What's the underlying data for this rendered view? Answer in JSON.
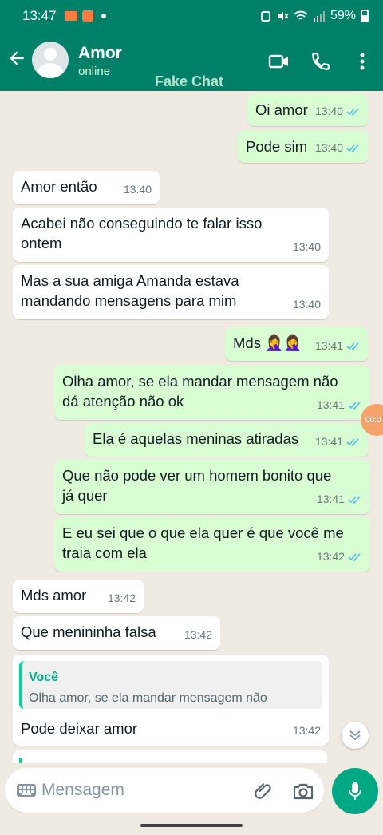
{
  "status_bar": {
    "time": "13:47",
    "battery": "59%"
  },
  "header": {
    "contact_name": "Amor",
    "contact_status": "online",
    "watermark": "Fake Chat",
    "icons": [
      "back-arrow-icon",
      "video-call-icon",
      "phone-icon",
      "more-options-icon"
    ]
  },
  "messages": [
    {
      "dir": "out",
      "text": "Oi amor",
      "time": "13:40",
      "read": true
    },
    {
      "dir": "out",
      "text": "Pode sim",
      "time": "13:40",
      "read": true
    },
    {
      "dir": "in",
      "text": "Amor então",
      "time": "13:40"
    },
    {
      "dir": "in",
      "text": "Acabei não conseguindo te falar isso\nontem",
      "time": "13:40"
    },
    {
      "dir": "in",
      "text": "Mas a sua amiga Amanda estava\nmandando mensagens para mim",
      "time": "13:40"
    },
    {
      "dir": "out",
      "text": "Mds 🤦‍♀️🤦‍♀️",
      "time": "13:41",
      "read": true
    },
    {
      "dir": "out",
      "text": "Olha amor, se ela mandar mensagem não\ndá atenção não ok",
      "time": "13:41",
      "read": true
    },
    {
      "dir": "out",
      "text": "Ela é aquelas meninas atiradas",
      "time": "13:41",
      "read": true
    },
    {
      "dir": "out",
      "text": "Que não pode ver um homem bonito que\njá quer",
      "time": "13:41",
      "read": true
    },
    {
      "dir": "out",
      "text": "E eu sei que o que ela quer é que você me\ntraia com ela",
      "time": "13:42",
      "read": true
    },
    {
      "dir": "in",
      "text": "Mds amor",
      "time": "13:42"
    },
    {
      "dir": "in",
      "text": "Que menininha falsa",
      "time": "13:42"
    },
    {
      "dir": "in",
      "text": "Pode deixar amor",
      "time": "13:42",
      "quote": {
        "author": "Você",
        "text": "Olha amor, se ela mandar mensagem não"
      }
    }
  ],
  "recording_badge": "00:0",
  "composer": {
    "placeholder": "Mensagem"
  },
  "colors": {
    "header": "#008069",
    "outgoing": "#d9fdd3",
    "incoming": "#ffffff",
    "chat_bg": "#efeae2",
    "accent": "#00a884",
    "read_tick": "#53bdeb"
  }
}
